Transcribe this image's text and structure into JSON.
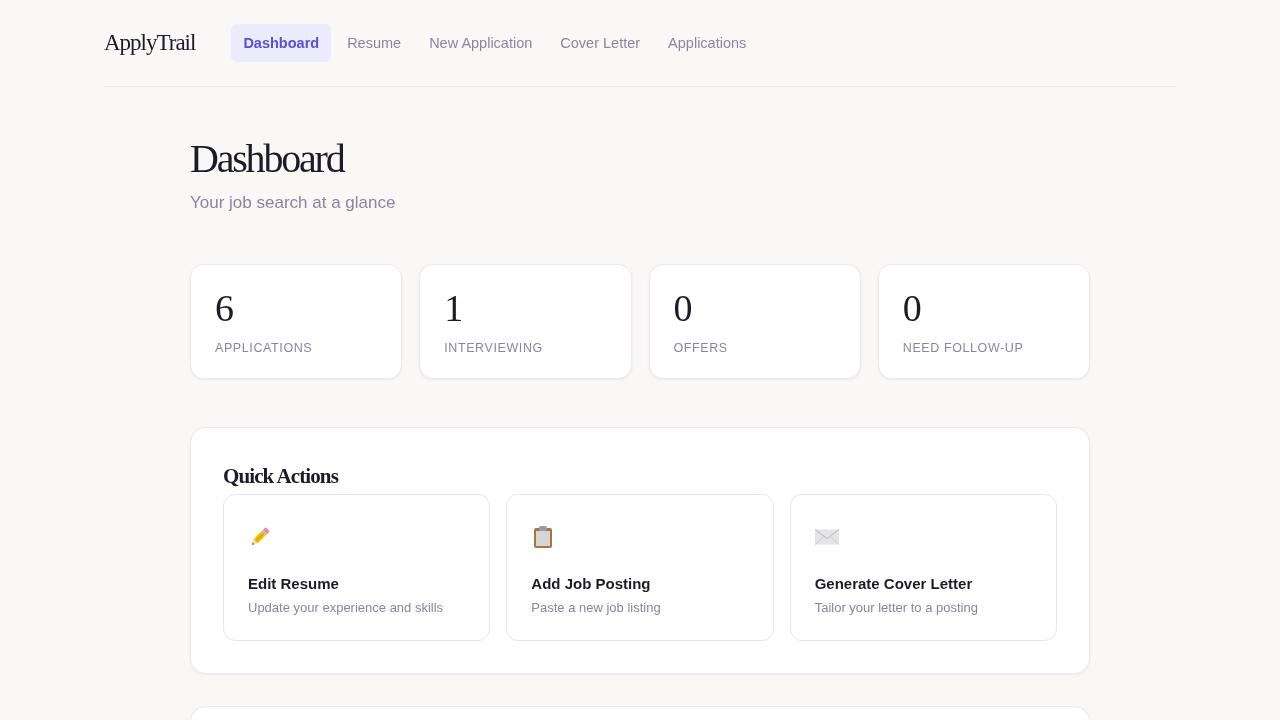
{
  "brand": {
    "name": "ApplyTrail"
  },
  "nav": [
    {
      "label": "Dashboard",
      "selected": true
    },
    {
      "label": "Resume",
      "selected": false
    },
    {
      "label": "New Application",
      "selected": false
    },
    {
      "label": "Cover Letter",
      "selected": false
    },
    {
      "label": "Applications",
      "selected": false
    }
  ],
  "page": {
    "title": "Dashboard",
    "subtitle": "Your job search at a glance"
  },
  "stats": [
    {
      "value": "6",
      "label": "APPLICATIONS"
    },
    {
      "value": "1",
      "label": "INTERVIEWING"
    },
    {
      "value": "0",
      "label": "OFFERS"
    },
    {
      "value": "0",
      "label": "NEED FOLLOW-UP"
    }
  ],
  "quick_actions": {
    "title": "Quick Actions",
    "items": [
      {
        "title": "Edit Resume",
        "description": "Update your experience and skills"
      },
      {
        "title": "Add Job Posting",
        "description": "Paste a new job listing"
      },
      {
        "title": "Generate Cover Letter",
        "description": "Tailor your letter to a posting"
      }
    ]
  }
}
